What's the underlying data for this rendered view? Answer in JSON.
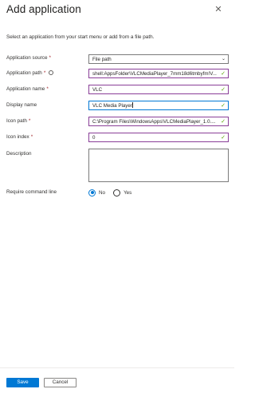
{
  "header": {
    "title": "Add application",
    "close_icon": "close-icon"
  },
  "intro": "Select an application from your start menu or add from a file path.",
  "form": {
    "application_source": {
      "label": "Application source",
      "required": "*",
      "value": "File path"
    },
    "application_path": {
      "label": "Application path",
      "required": "*",
      "value": "shell:AppsFolder\\VLCMediaPlayer_7mm18d6tmbyfm!V..."
    },
    "application_name": {
      "label": "Application name",
      "required": "*",
      "value": "VLC"
    },
    "display_name": {
      "label": "Display name",
      "value": "VLC Media Player"
    },
    "icon_path": {
      "label": "Icon path",
      "required": "*",
      "value": "C:\\Program Files\\WindowsApps\\VLCMediaPlayer_1.0...."
    },
    "icon_index": {
      "label": "Icon index",
      "required": "*",
      "value": "0"
    },
    "description": {
      "label": "Description",
      "value": ""
    },
    "require_command_line": {
      "label": "Require command line",
      "options": [
        "No",
        "Yes"
      ],
      "selected": "No"
    }
  },
  "footer": {
    "save_label": "Save",
    "cancel_label": "Cancel"
  },
  "colors": {
    "accent": "#0078d4",
    "valid_check": "#57a300",
    "required": "#a4262c",
    "valid_border": "#8a3f98"
  }
}
